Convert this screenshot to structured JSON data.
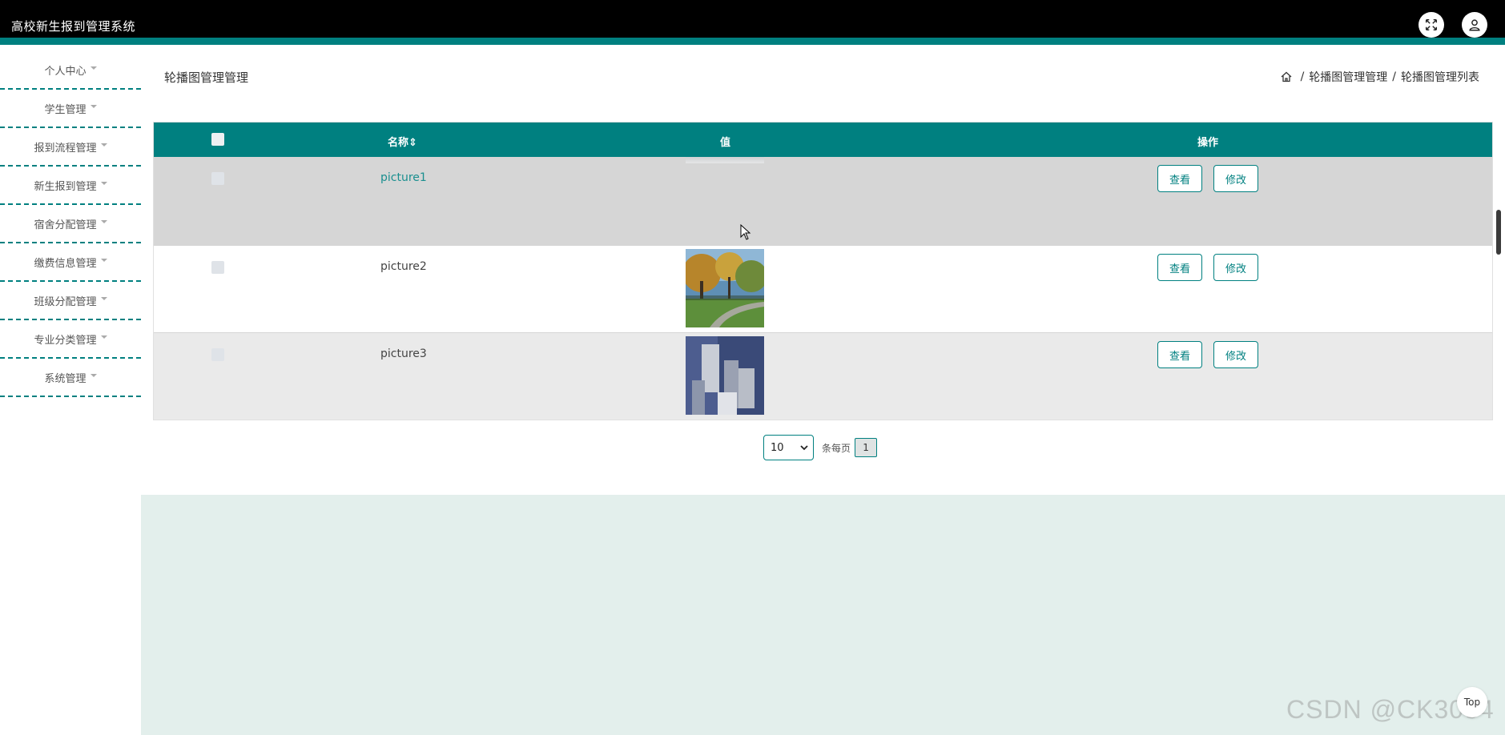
{
  "header": {
    "app_title": "高校新生报到管理系统",
    "icons": [
      "fullscreen-icon",
      "user-icon"
    ],
    "accent_color": "#008080"
  },
  "sidebar": {
    "items": [
      {
        "label": "个人中心"
      },
      {
        "label": "学生管理"
      },
      {
        "label": "报到流程管理"
      },
      {
        "label": "新生报到管理"
      },
      {
        "label": "宿舍分配管理"
      },
      {
        "label": "缴费信息管理"
      },
      {
        "label": "班级分配管理"
      },
      {
        "label": "专业分类管理"
      },
      {
        "label": "系统管理"
      }
    ]
  },
  "main": {
    "page_title": "轮播图管理管理",
    "breadcrumb": [
      "轮播图管理管理",
      "轮播图管理列表"
    ],
    "table": {
      "columns": [
        "名称",
        "值",
        "操作"
      ],
      "sort_indicator": "⇕",
      "rows": [
        {
          "name": "picture1",
          "view_label": "查看",
          "edit_label": "修改"
        },
        {
          "name": "picture2",
          "view_label": "查看",
          "edit_label": "修改"
        },
        {
          "name": "picture3",
          "view_label": "查看",
          "edit_label": "修改"
        }
      ]
    },
    "pagination": {
      "page_size": "10",
      "per_page_label": "条每页",
      "current_page": "1"
    }
  },
  "top_button": "Top",
  "watermark": "CSDN @CK3034"
}
